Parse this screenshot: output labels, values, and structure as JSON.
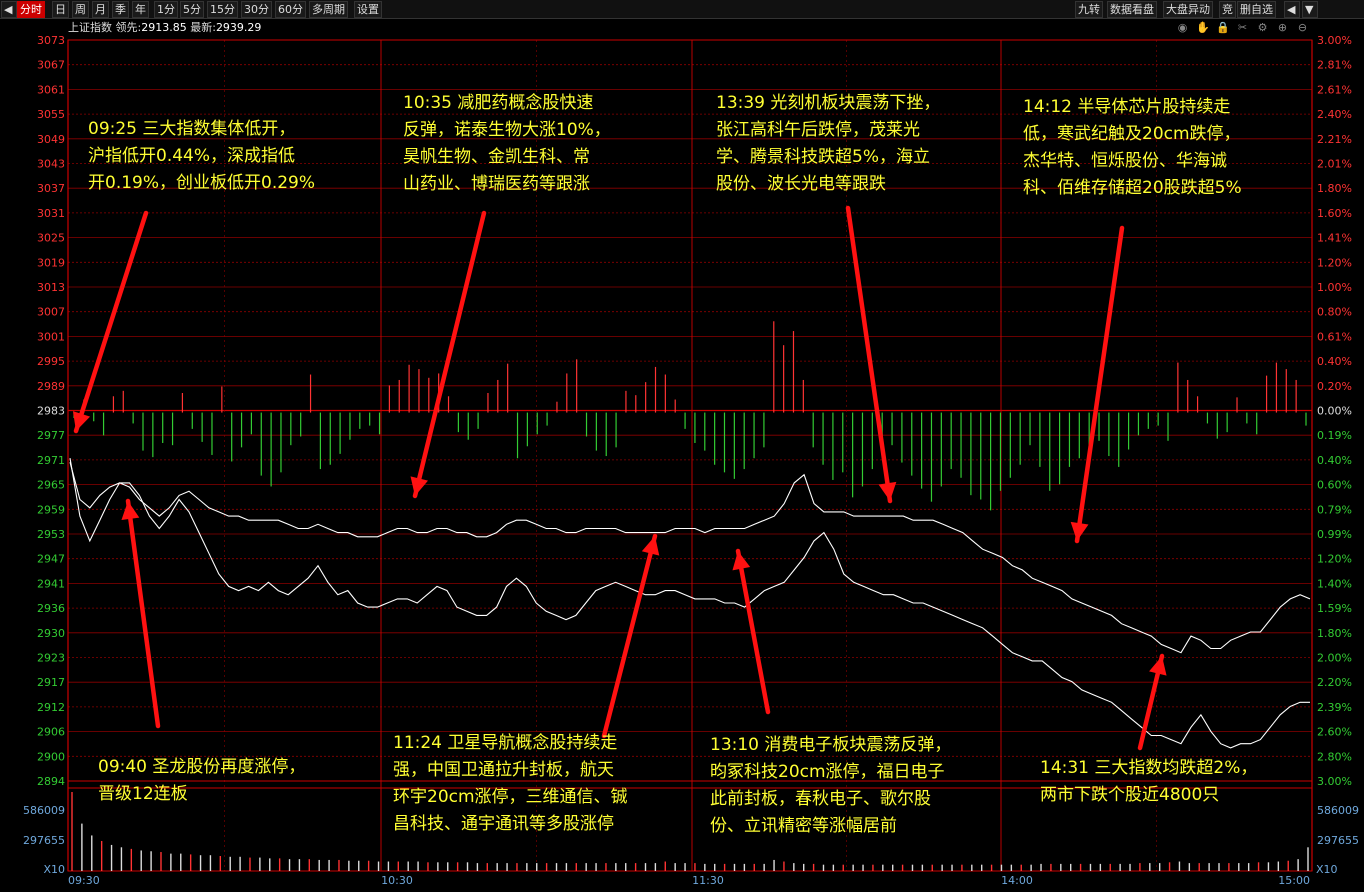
{
  "toolbar": {
    "left_icon": "◀",
    "tabs": [
      "分时",
      "日",
      "周",
      "月",
      "季",
      "年",
      "1分",
      "5分",
      "15分",
      "30分",
      "60分",
      "多周期",
      "设置"
    ],
    "right_items": [
      "九转",
      "数据看盘",
      "大盘异动",
      "竞",
      "删自选"
    ],
    "right_arrows": [
      "◀",
      "▼"
    ]
  },
  "info": {
    "name": "上证指数",
    "lead_label": "领先:",
    "lead_value": "2913.85",
    "latest_label": "最新:",
    "latest_value": "2939.29"
  },
  "ctrl_icons": [
    "eye-icon",
    "hand-icon",
    "lock-icon",
    "scissors-icon",
    "settings-icon",
    "zoom-in-icon",
    "zoom-out-icon"
  ],
  "colors": {
    "up": "#ff3333",
    "down": "#33cc33",
    "price": "#ffffff",
    "avg": "#ffffff",
    "grid": "#8b0000",
    "annotation": "#ffff33",
    "arrow": "#ff1111"
  },
  "chart_data": {
    "type": "line",
    "title": "上证指数",
    "y_left_labels": [
      "3073",
      "3067",
      "3061",
      "3055",
      "3049",
      "3043",
      "3037",
      "3031",
      "3025",
      "3019",
      "3013",
      "3007",
      "3001",
      "2995",
      "2989",
      "2983",
      "2977",
      "2971",
      "2965",
      "2959",
      "2953",
      "2947",
      "2941",
      "2936",
      "2930",
      "2923",
      "2917",
      "2912",
      "2906",
      "2900",
      "2894"
    ],
    "y_right_labels": [
      "3.00%",
      "2.81%",
      "2.61%",
      "2.40%",
      "2.21%",
      "2.01%",
      "1.80%",
      "1.60%",
      "1.41%",
      "1.20%",
      "1.00%",
      "0.80%",
      "0.61%",
      "0.40%",
      "0.20%",
      "0.00%",
      "0.19%",
      "0.40%",
      "0.60%",
      "0.79%",
      "0.99%",
      "1.20%",
      "1.40%",
      "1.59%",
      "1.80%",
      "2.00%",
      "2.20%",
      "2.39%",
      "2.60%",
      "2.80%",
      "3.00%"
    ],
    "volume_labels": [
      "586009",
      "297655",
      "X10"
    ],
    "x_labels": [
      "09:30",
      "10:30",
      "11:30",
      "14:00",
      "15:00"
    ],
    "ylim": [
      2894,
      3073
    ],
    "prev_close": 2983,
    "price_series": [
      2972,
      2958,
      2952,
      2957,
      2962,
      2966,
      2966,
      2963,
      2958,
      2955,
      2958,
      2962,
      2959,
      2954,
      2949,
      2944,
      2941,
      2940,
      2941,
      2940,
      2942,
      2940,
      2939,
      2941,
      2943,
      2946,
      2942,
      2939,
      2940,
      2937,
      2936,
      2936,
      2937,
      2938,
      2938,
      2937,
      2939,
      2941,
      2940,
      2936,
      2935,
      2934,
      2934,
      2936,
      2941,
      2943,
      2941,
      2937,
      2935,
      2934,
      2933,
      2934,
      2937,
      2940,
      2941,
      2942,
      2941,
      2940,
      2939,
      2939,
      2940,
      2940,
      2939,
      2938,
      2938,
      2938,
      2937,
      2937,
      2936,
      2938,
      2940,
      2941,
      2942,
      2945,
      2948,
      2952,
      2954,
      2950,
      2944,
      2942,
      2941,
      2940,
      2939,
      2939,
      2938,
      2937,
      2937,
      2936,
      2935,
      2934,
      2933,
      2932,
      2931,
      2929,
      2927,
      2925,
      2924,
      2923,
      2923,
      2921,
      2919,
      2918,
      2916,
      2915,
      2914,
      2913,
      2911,
      2909,
      2907,
      2905,
      2905,
      2904,
      2903,
      2907,
      2910,
      2906,
      2903,
      2902,
      2903,
      2903,
      2904,
      2907,
      2910,
      2912,
      2913,
      2913
    ],
    "avg_series": [
      2971,
      2962,
      2960,
      2963,
      2965,
      2966,
      2965,
      2962,
      2960,
      2958,
      2960,
      2963,
      2964,
      2962,
      2960,
      2959,
      2958,
      2958,
      2957,
      2957,
      2957,
      2957,
      2956,
      2955,
      2955,
      2956,
      2955,
      2954,
      2954,
      2953,
      2953,
      2953,
      2954,
      2955,
      2955,
      2954,
      2954,
      2955,
      2955,
      2954,
      2954,
      2953,
      2953,
      2954,
      2956,
      2957,
      2957,
      2956,
      2955,
      2955,
      2954,
      2954,
      2955,
      2955,
      2955,
      2955,
      2954,
      2954,
      2954,
      2954,
      2954,
      2955,
      2955,
      2955,
      2954,
      2955,
      2955,
      2955,
      2955,
      2956,
      2957,
      2958,
      2961,
      2966,
      2968,
      2961,
      2959,
      2959,
      2959,
      2958,
      2958,
      2958,
      2958,
      2958,
      2958,
      2957,
      2957,
      2957,
      2956,
      2955,
      2954,
      2952,
      2950,
      2949,
      2948,
      2946,
      2945,
      2943,
      2942,
      2941,
      2940,
      2938,
      2937,
      2936,
      2935,
      2934,
      2932,
      2931,
      2930,
      2929,
      2927,
      2926,
      2925,
      2929,
      2928,
      2926,
      2926,
      2928,
      2929,
      2930,
      2930,
      2933,
      2936,
      2938,
      2939,
      2938
    ],
    "breadth_series": [
      -0.5,
      1.2,
      -0.8,
      -2.1,
      1.5,
      2.0,
      -1.0,
      -3.5,
      -4.1,
      -2.8,
      -3.0,
      1.8,
      -1.5,
      -2.7,
      -3.9,
      2.4,
      -4.5,
      -3.2,
      -2.0,
      -5.8,
      -6.8,
      -5.5,
      -3.0,
      -2.2,
      3.5,
      -5.2,
      -4.8,
      -3.8,
      -2.5,
      -1.5,
      -1.2,
      -2.0,
      2.5,
      3.0,
      4.4,
      4.0,
      3.2,
      3.6,
      1.5,
      -1.8,
      -2.5,
      -1.5,
      1.8,
      3.0,
      4.5,
      -4.2,
      -3.1,
      -2.0,
      -1.2,
      1.0,
      3.6,
      4.9,
      -2.2,
      -3.5,
      -4.0,
      -3.2,
      2.0,
      1.6,
      2.8,
      4.2,
      3.5,
      1.2,
      -1.5,
      -2.8,
      -3.5,
      -4.8,
      -5.5,
      -6.1,
      -5.2,
      -4.2,
      -3.2,
      8.4,
      6.2,
      7.5,
      3.0,
      -3.2,
      -4.8,
      -6.2,
      -5.5,
      -7.8,
      -6.8,
      -5.2,
      -4.0,
      -3.0,
      -4.6,
      -5.8,
      -7.0,
      -8.2,
      -6.8,
      -5.2,
      -6.0,
      -7.6,
      -8.0,
      -9.0,
      -7.2,
      -6.0,
      -4.8,
      -3.0,
      -5.0,
      -7.2,
      -6.6,
      -5.0,
      -4.2,
      -3.4,
      -2.6,
      -4.0,
      -5.0,
      -3.4,
      -2.1,
      -1.5,
      -1.2,
      -2.6,
      4.6,
      3.0,
      1.5,
      -1.0,
      -2.4,
      -1.8,
      1.4,
      -1.0,
      -2.0,
      3.4,
      4.6,
      4.0,
      3.0,
      -1.2
    ],
    "volume_series": [
      1.0,
      0.6,
      0.45,
      0.38,
      0.33,
      0.3,
      0.28,
      0.26,
      0.25,
      0.24,
      0.22,
      0.22,
      0.21,
      0.2,
      0.2,
      0.19,
      0.18,
      0.18,
      0.17,
      0.17,
      0.16,
      0.16,
      0.15,
      0.15,
      0.15,
      0.14,
      0.14,
      0.14,
      0.13,
      0.13,
      0.13,
      0.12,
      0.12,
      0.12,
      0.12,
      0.12,
      0.11,
      0.11,
      0.11,
      0.11,
      0.11,
      0.1,
      0.1,
      0.1,
      0.1,
      0.1,
      0.1,
      0.1,
      0.1,
      0.1,
      0.1,
      0.1,
      0.1,
      0.1,
      0.1,
      0.1,
      0.1,
      0.1,
      0.1,
      0.1,
      0.12,
      0.1,
      0.1,
      0.1,
      0.09,
      0.09,
      0.09,
      0.09,
      0.09,
      0.09,
      0.09,
      0.14,
      0.12,
      0.1,
      0.09,
      0.09,
      0.08,
      0.08,
      0.08,
      0.08,
      0.08,
      0.08,
      0.08,
      0.08,
      0.08,
      0.08,
      0.08,
      0.08,
      0.08,
      0.08,
      0.08,
      0.08,
      0.08,
      0.08,
      0.08,
      0.08,
      0.08,
      0.08,
      0.09,
      0.09,
      0.09,
      0.09,
      0.09,
      0.09,
      0.09,
      0.09,
      0.09,
      0.09,
      0.1,
      0.1,
      0.1,
      0.11,
      0.12,
      0.1,
      0.1,
      0.1,
      0.1,
      0.1,
      0.1,
      0.1,
      0.11,
      0.11,
      0.12,
      0.13,
      0.15,
      0.3
    ]
  },
  "annotations": [
    {
      "id": "a1",
      "lines": [
        "09:25 三大指数集体低开，",
        "沪指低开0.44%，深成指低",
        "开0.19%，创业板低开0.29%"
      ]
    },
    {
      "id": "a2",
      "lines": [
        "10:35 减肥药概念股快速",
        "反弹，诺泰生物大涨10%，",
        "昊帆生物、金凯生科、常",
        "山药业、博瑞医药等跟涨"
      ]
    },
    {
      "id": "a3",
      "lines": [
        "13:39 光刻机板块震荡下挫，",
        "张江高科午后跌停，茂莱光",
        "学、腾景科技跌超5%，海立",
        "股份、波长光电等跟跌"
      ]
    },
    {
      "id": "a4",
      "lines": [
        "14:12 半导体芯片股持续走",
        "低，寒武纪触及20cm跌停，",
        "杰华特、恒烁股份、华海诚",
        "科、佰维存储超20股跌超5%"
      ]
    },
    {
      "id": "a5",
      "lines": [
        "09:40 圣龙股份再度涨停，",
        "晋级12连板"
      ]
    },
    {
      "id": "a6",
      "lines": [
        "11:24 卫星导航概念股持续走",
        "强，中国卫通拉升封板，航天",
        "环宇20cm涨停，三维通信、铖",
        "昌科技、通宇通讯等多股涨停"
      ]
    },
    {
      "id": "a7",
      "lines": [
        "13:10 消费电子板块震荡反弹，",
        "昀冢科技20cm涨停，福日电子",
        "此前封板，春秋电子、歌尔股",
        "份、立讯精密等涨幅居前"
      ]
    },
    {
      "id": "a8",
      "lines": [
        "14:31 三大指数均跌超2%，",
        "两市下跌个股近4800只"
      ]
    }
  ]
}
